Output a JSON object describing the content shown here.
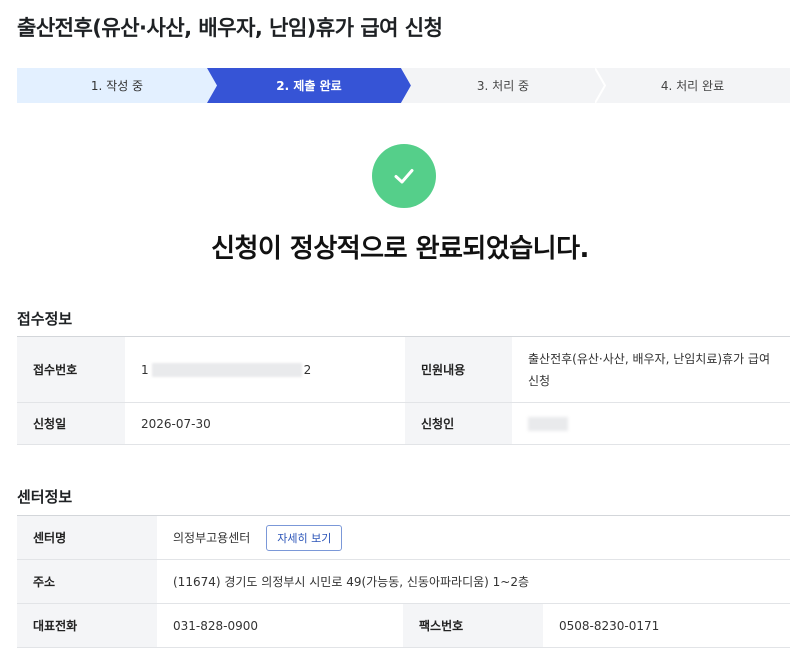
{
  "page_title": "출산전후(유산·사산, 배우자, 난임)휴가 급여 신청",
  "steps": [
    "1. 작성 중",
    "2. 제출 완료",
    "3. 처리 중",
    "4. 처리 완료"
  ],
  "complete_message": "신청이 정상적으로 완료되었습니다.",
  "receipt": {
    "title": "접수정보",
    "receipt_no_label": "접수번호",
    "receipt_no_prefix": "1",
    "receipt_no_suffix": "2",
    "civil_label": "민원내용",
    "civil_value": "출산전후(유산·사산, 배우자, 난임치료)휴가 급여 신청",
    "date_label": "신청일",
    "date_value": "2026-07-30",
    "applicant_label": "신청인"
  },
  "center": {
    "title": "센터정보",
    "name_label": "센터명",
    "name_value": "의정부고용센터",
    "detail_button": "자세히 보기",
    "address_label": "주소",
    "address_value": "(11674) 경기도 의정부시 시민로 49(가능동, 신동아파라디움) 1~2층",
    "phone_label": "대표전화",
    "phone_value": "031-828-0900",
    "fax_label": "팩스번호",
    "fax_value": "0508-8230-0171"
  },
  "colors": {
    "accent": "#3654d6",
    "step_done": "#e3f0ff",
    "success": "#55cf8a"
  }
}
